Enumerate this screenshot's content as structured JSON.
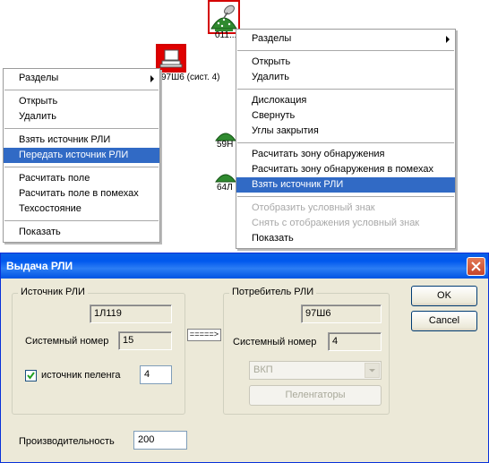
{
  "map": {
    "units": [
      {
        "label": "011..."
      },
      {
        "label": "97Ш6 (сист. 4)"
      },
      {
        "label": "59Н"
      },
      {
        "label": "64Л"
      }
    ]
  },
  "left_menu": {
    "items": [
      {
        "label": "Разделы",
        "submenu": true
      },
      {
        "label": "Открыть"
      },
      {
        "label": "Удалить"
      },
      {
        "label": "Взять источник РЛИ"
      },
      {
        "label": "Передать источник РЛИ",
        "selected": true
      },
      {
        "label": "Расчитать поле"
      },
      {
        "label": "Расчитать поле в помехах"
      },
      {
        "label": "Техсостояние"
      },
      {
        "label": "Показать"
      }
    ]
  },
  "right_menu": {
    "items": [
      {
        "label": "Разделы",
        "submenu": true
      },
      {
        "label": "Открыть"
      },
      {
        "label": "Удалить"
      },
      {
        "label": "Дислокация"
      },
      {
        "label": "Свернуть"
      },
      {
        "label": "Углы закрытия"
      },
      {
        "label": "Расчитать зону обнаружения"
      },
      {
        "label": "Расчитать зону обнаружения в помехах"
      },
      {
        "label": "Взять источник РЛИ",
        "selected": true
      },
      {
        "label": "Отобразить условный знак",
        "disabled": true
      },
      {
        "label": "Снять с отображения условный знак",
        "disabled": true
      },
      {
        "label": "Показать"
      }
    ]
  },
  "dialog": {
    "title": "Выдача РЛИ",
    "source": {
      "group_title": "Источник РЛИ",
      "name": "1Л119",
      "sysnum_label": "Системный номер",
      "sysnum": "15",
      "bearing_checkbox_label": "источник пеленга",
      "bearing_checked": true,
      "bearing_value": "4"
    },
    "arrow_label": "=====>",
    "consumer": {
      "group_title": "Потребитель РЛИ",
      "name": "97Ш6",
      "sysnum_label": "Системный номер",
      "sysnum": "4",
      "combo_value": "ВКП",
      "direction_finders_button": "Пеленгаторы"
    },
    "performance_label": "Производительность",
    "performance_value": "200",
    "ok_label": "OK",
    "cancel_label": "Cancel"
  }
}
